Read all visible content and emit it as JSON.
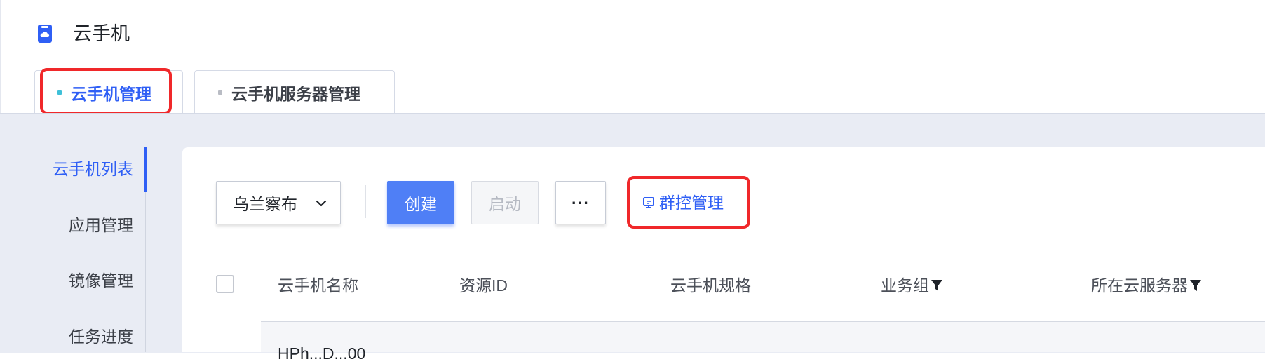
{
  "app": {
    "title": "云手机",
    "icon": "cloud-phone-icon"
  },
  "tabs": [
    {
      "label": "云手机管理",
      "active": true
    },
    {
      "label": "云手机服务器管理",
      "active": false
    }
  ],
  "sidebar": {
    "items": [
      {
        "label": "云手机列表",
        "active": true
      },
      {
        "label": "应用管理",
        "active": false
      },
      {
        "label": "镜像管理",
        "active": false
      },
      {
        "label": "任务进度",
        "active": false
      }
    ]
  },
  "toolbar": {
    "region": "乌兰察布",
    "create_label": "创建",
    "start_label": "启动",
    "more_label": "···",
    "group_control_label": "群控管理",
    "group_control_icon": "monitor-icon"
  },
  "table": {
    "columns": [
      {
        "label": "云手机名称",
        "filter": false
      },
      {
        "label": "资源ID",
        "filter": false
      },
      {
        "label": "云手机规格",
        "filter": false
      },
      {
        "label": "业务组",
        "filter": true
      },
      {
        "label": "所在云服务器",
        "filter": true
      }
    ],
    "first_row_partial": "HPh...D...00"
  },
  "colors": {
    "accent": "#2f5ff5",
    "highlight": "#f0282a",
    "bg": "#e9ecf4"
  }
}
